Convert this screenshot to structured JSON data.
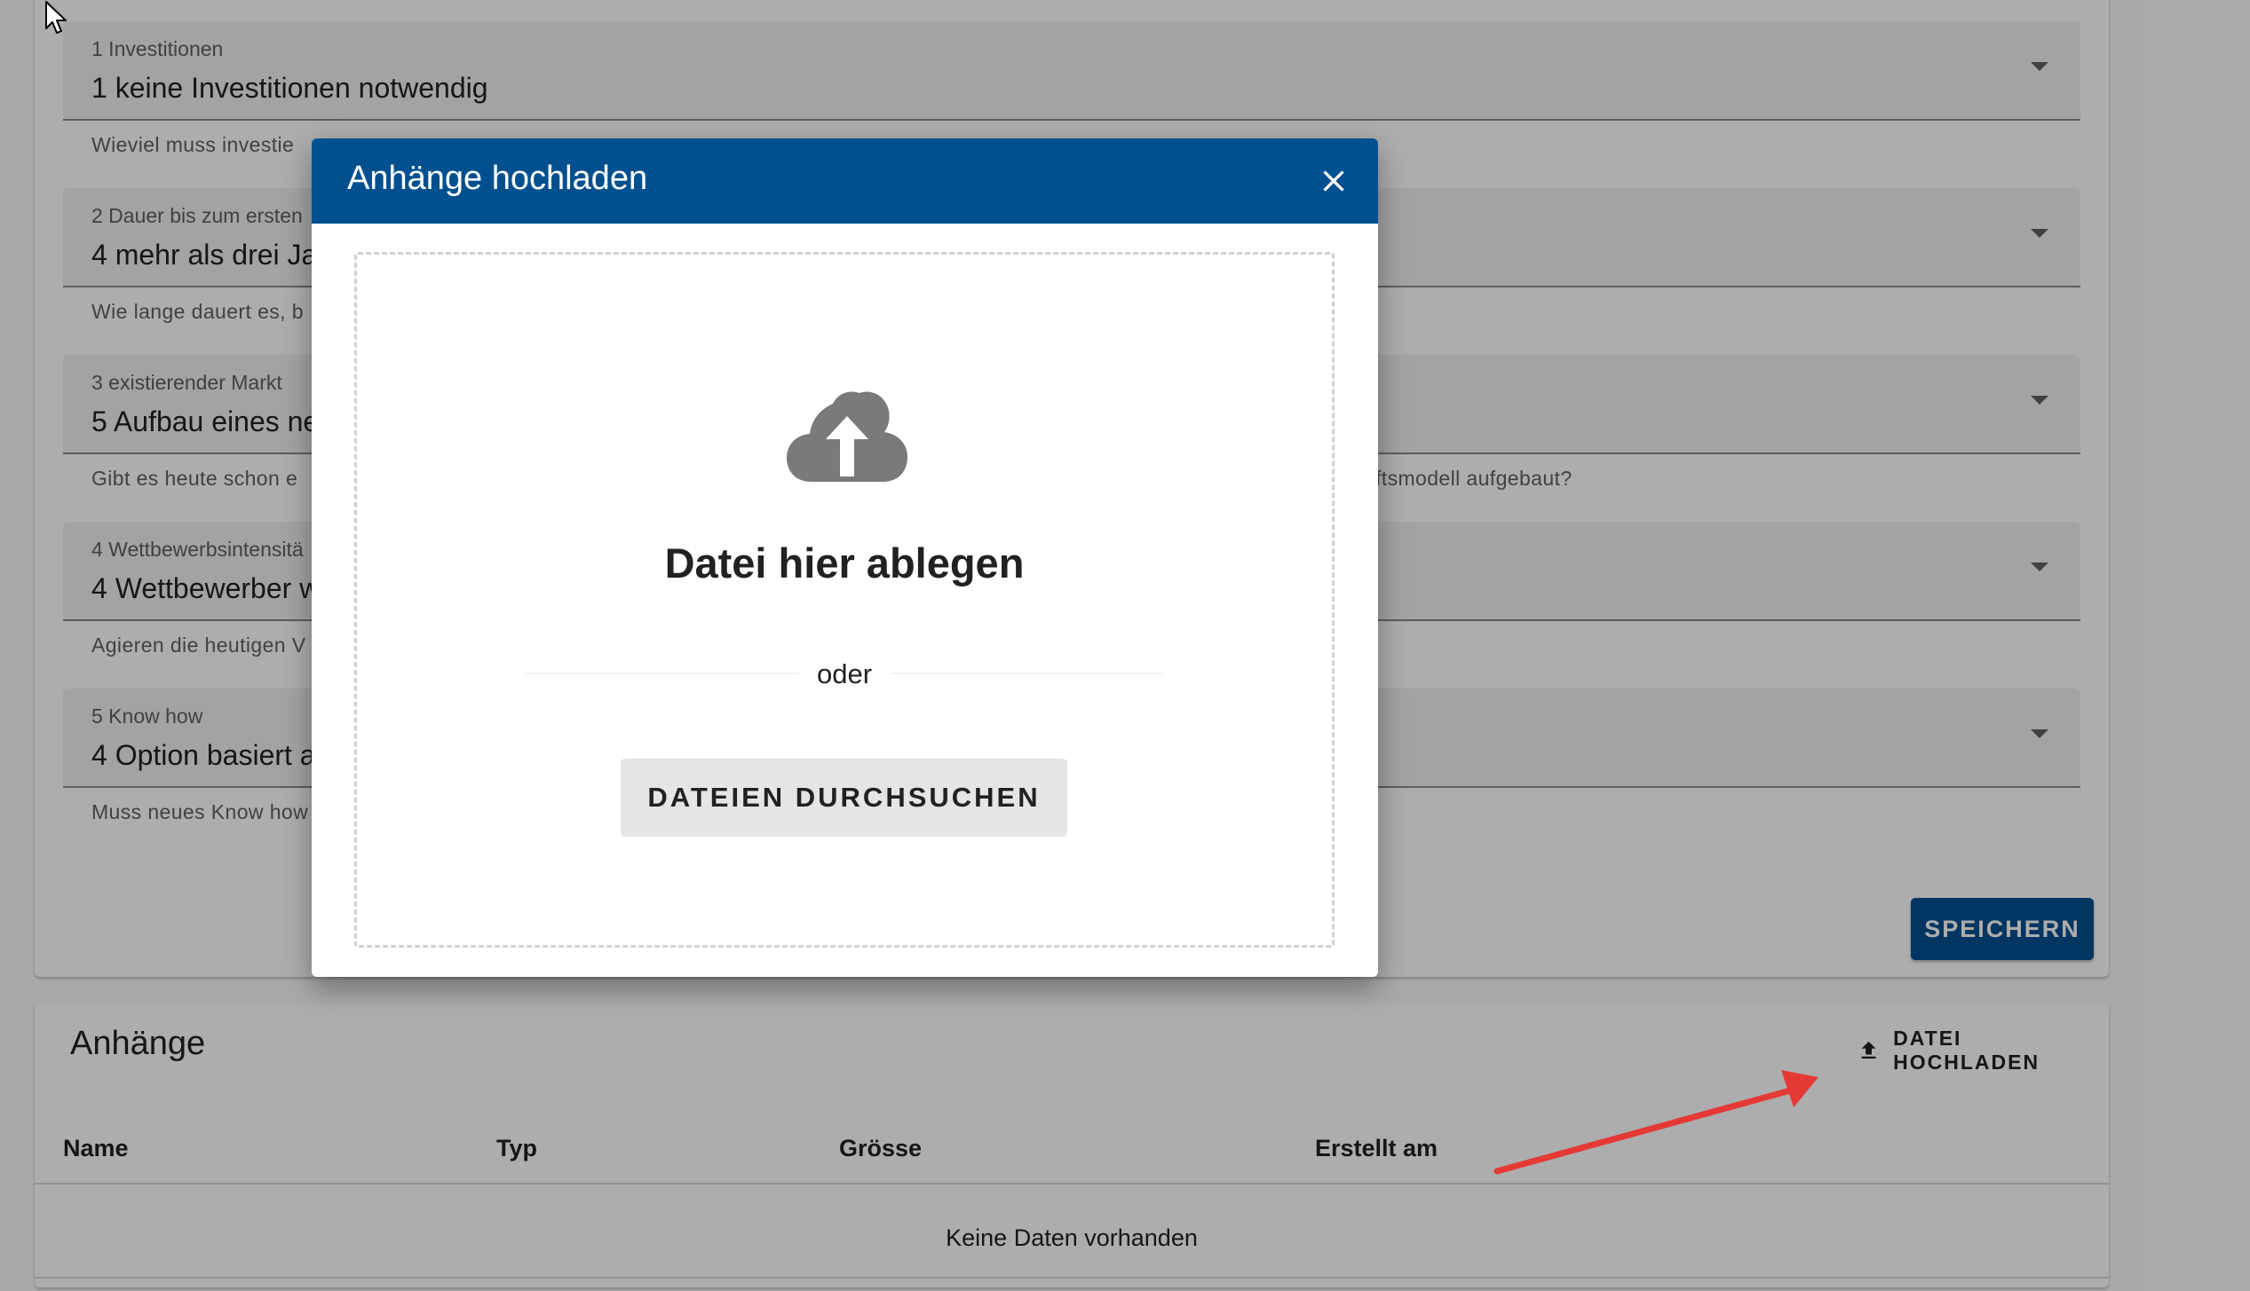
{
  "form": {
    "fields": [
      {
        "label": "1 Investitionen",
        "value": "1 keine Investitionen notwendig",
        "hint": "Wieviel muss investie"
      },
      {
        "label": "2 Dauer bis zum ersten",
        "value": "4 mehr als drei Ja",
        "hint": "Wie lange dauert es, b"
      },
      {
        "label": "3 existierender Markt",
        "value": "5 Aufbau eines ne",
        "hint": "Gibt es heute schon e",
        "hint_right": "ftsmodell aufgebaut?"
      },
      {
        "label": "4 Wettbewerbsintensitä",
        "value": "4 Wettbewerber w",
        "hint": "Agieren die heutigen V"
      },
      {
        "label": "5 Know how",
        "value": "4 Option basiert a",
        "hint": "Muss neues Know how"
      }
    ],
    "save_label": "SPEICHERN"
  },
  "attachments": {
    "title": "Anhänge",
    "upload_label": "DATEI HOCHLADEN",
    "columns": [
      "Name",
      "Typ",
      "Grösse",
      "Erstellt am"
    ],
    "empty_text": "Keine Daten vorhanden"
  },
  "dialog": {
    "title": "Anhänge hochladen",
    "drop_title": "Datei hier ablegen",
    "or_text": "oder",
    "browse_label": "DATEIEN DURCHSUCHEN",
    "icons": {
      "upload": "cloud-upload-icon",
      "close": "close-icon"
    }
  },
  "colors": {
    "primary": "#00508f",
    "annotation": "#e53935",
    "overlay": "rgba(0,0,0,0.32)"
  }
}
